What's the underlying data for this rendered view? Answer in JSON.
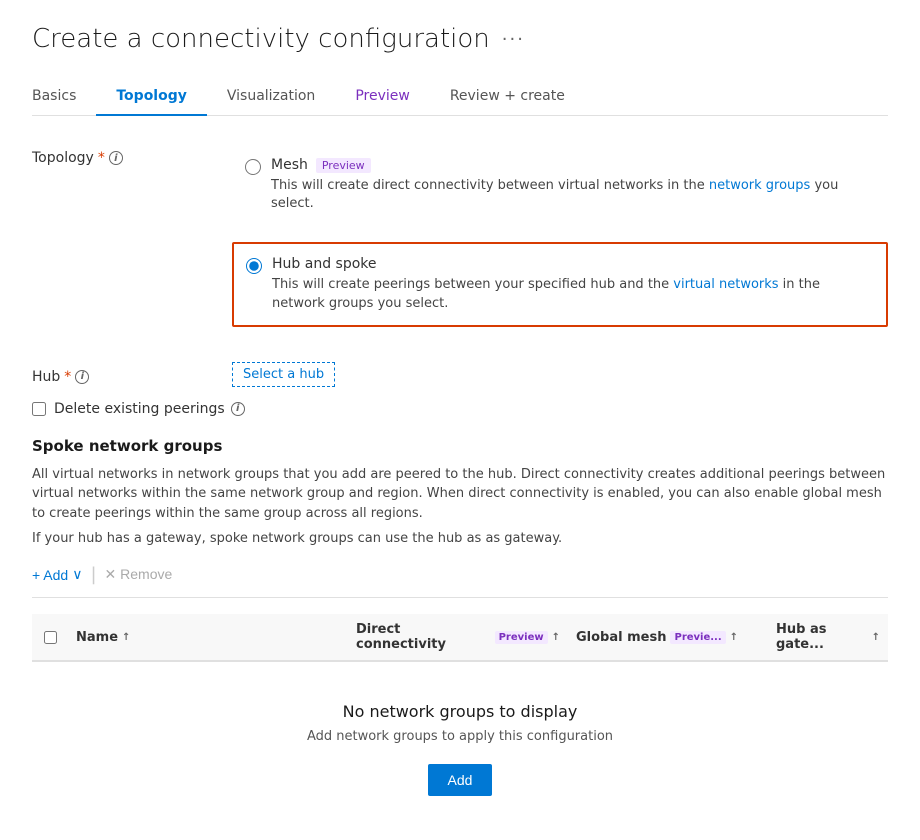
{
  "page": {
    "title": "Create a connectivity configuration",
    "more_icon": "•••"
  },
  "tabs": [
    {
      "id": "basics",
      "label": "Basics",
      "active": false
    },
    {
      "id": "topology",
      "label": "Topology",
      "active": true
    },
    {
      "id": "visualization",
      "label": "Visualization",
      "active": false
    },
    {
      "id": "preview",
      "label": "Preview",
      "active": false,
      "is_preview": true
    },
    {
      "id": "review",
      "label": "Review + create",
      "active": false
    }
  ],
  "topology": {
    "label": "Topology",
    "required_marker": "*",
    "options": [
      {
        "id": "mesh",
        "label": "Mesh",
        "badge": "Preview",
        "description": "This will create direct connectivity between virtual networks in the network groups you select.",
        "selected": false
      },
      {
        "id": "hub_spoke",
        "label": "Hub and spoke",
        "description": "This will create peerings between your specified hub and the virtual networks in the network groups you select.",
        "selected": true
      }
    ]
  },
  "hub": {
    "label": "Hub",
    "required_marker": "*",
    "select_link_text": "Select a hub"
  },
  "delete_peerings": {
    "label": "Delete existing peerings"
  },
  "spoke_network_groups": {
    "title": "Spoke network groups",
    "description1": "All virtual networks in network groups that you add are peered to the hub. Direct connectivity creates additional peerings between virtual networks within the same network group and region. When direct connectivity is enabled, you can also enable global mesh to create peerings within the same group across all regions.",
    "description2": "If your hub has a gateway, spoke network groups can use the hub as as gateway.",
    "toolbar": {
      "add_label": "+ Add",
      "remove_label": "✕ Remove"
    },
    "table": {
      "columns": [
        {
          "id": "select",
          "label": ""
        },
        {
          "id": "name",
          "label": "Name",
          "sort": "↑"
        },
        {
          "id": "direct_connectivity",
          "label": "Direct connectivity",
          "badge": "Preview",
          "sort": "↑"
        },
        {
          "id": "global_mesh",
          "label": "Global mesh",
          "badge": "Previe...",
          "sort": "↑"
        },
        {
          "id": "hub_as_gate",
          "label": "Hub as gate...",
          "sort": "↑"
        }
      ]
    },
    "empty_state": {
      "title": "No network groups to display",
      "description": "Add network groups to apply this configuration",
      "add_button": "Add"
    }
  },
  "colors": {
    "primary": "#0078d4",
    "preview_text": "#7b2fbe",
    "preview_bg": "#f3e8ff",
    "selected_border": "#d83b01",
    "accent": "#0078d4"
  }
}
